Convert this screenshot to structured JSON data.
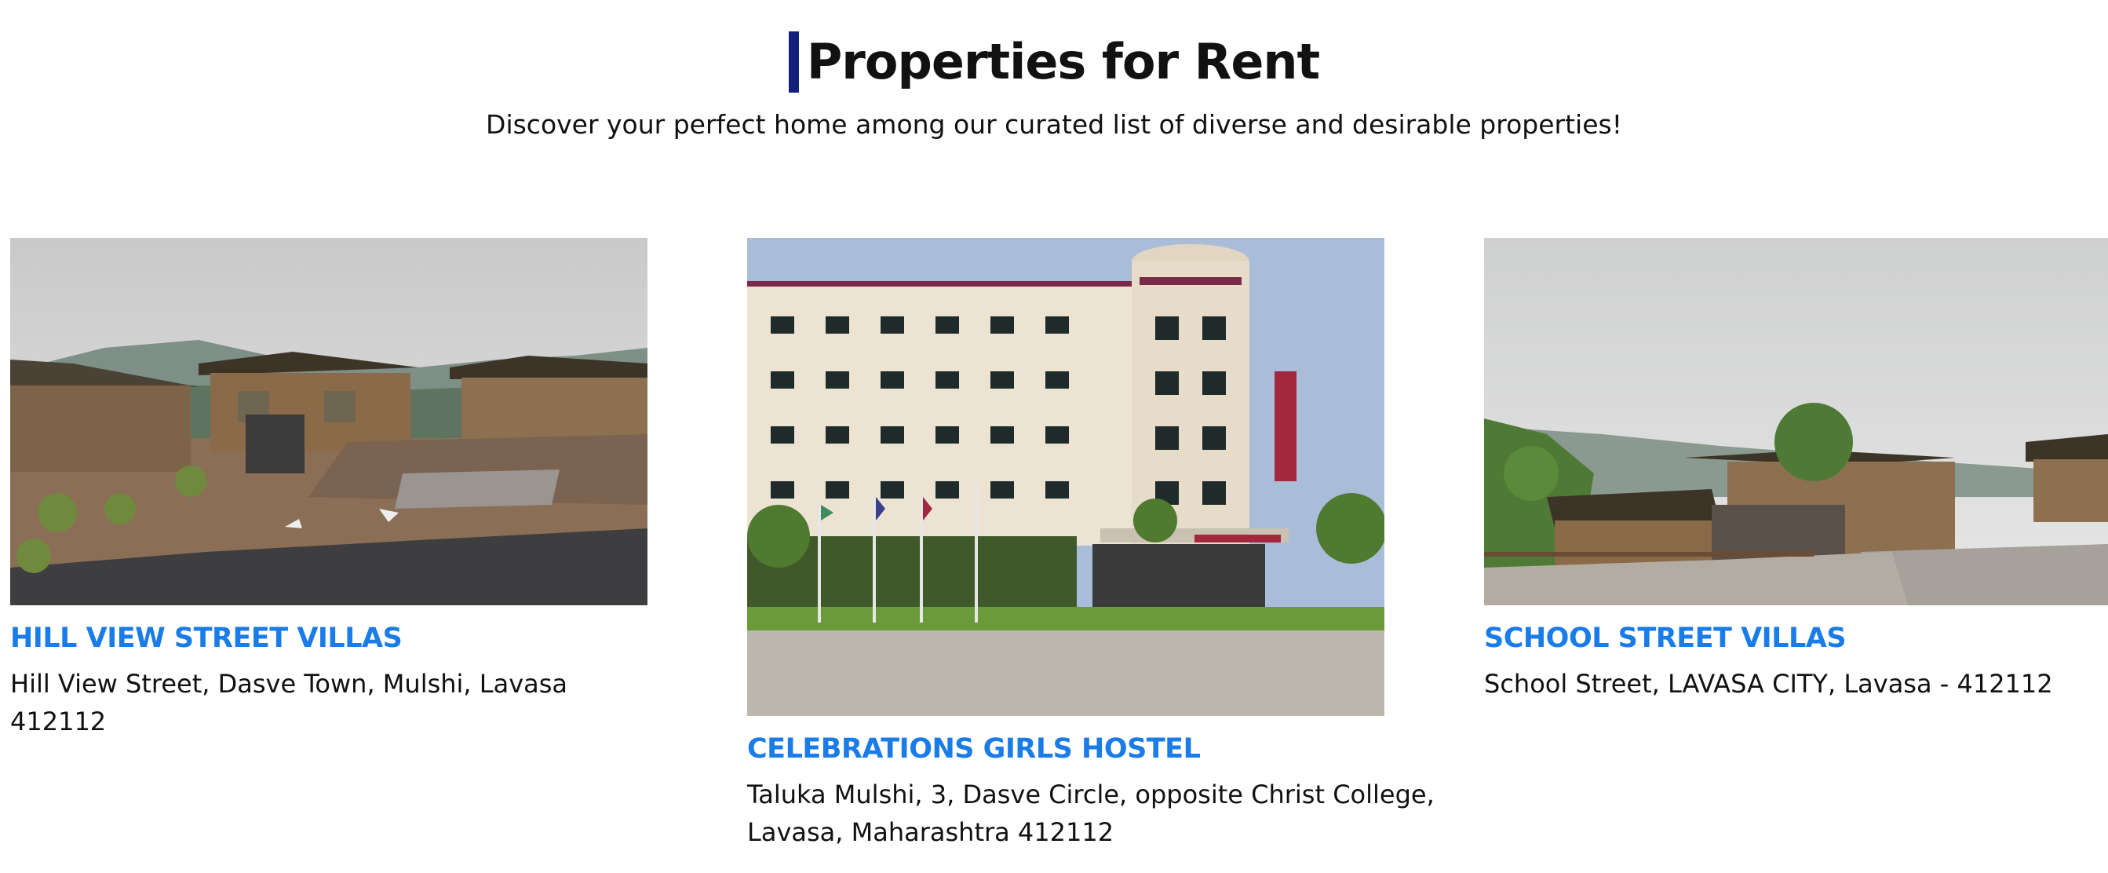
{
  "header": {
    "title": "Properties for Rent",
    "subtitle": "Discover your perfect home among our curated list of diverse and desirable properties!"
  },
  "colors": {
    "accent_bar": "#13207a",
    "property_name": "#1a7ce8",
    "text": "#111111"
  },
  "properties": [
    {
      "name": "HILL VIEW STREET VILLAS",
      "address": "Hill View Street, Dasve Town, Mulshi, Lavasa 412112",
      "image": "hill-view-villas-photo"
    },
    {
      "name": "CELEBRATIONS GIRLS HOSTEL",
      "address": "Taluka Mulshi, 3, Dasve Circle, opposite Christ College, Lavasa, Maharashtra 412112",
      "image": "celebrations-hostel-photo"
    },
    {
      "name": "SCHOOL STREET VILLAS",
      "address": "School Street, LAVASA CITY, Lavasa - 412112",
      "image": "school-street-villas-photo"
    }
  ]
}
